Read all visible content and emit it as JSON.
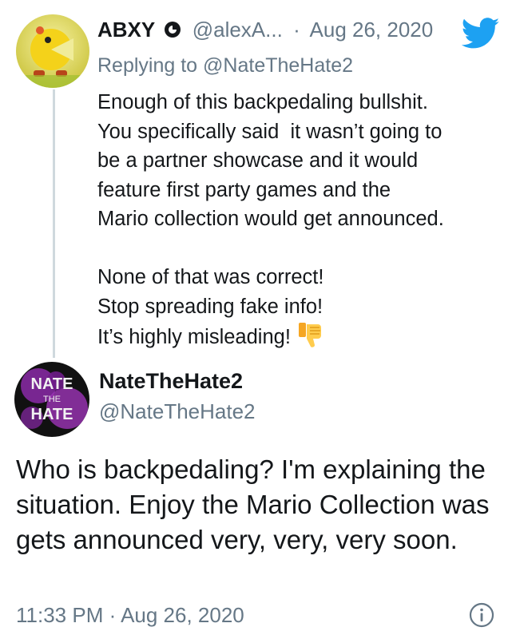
{
  "reply_tweet": {
    "display_name": "ABXY",
    "handle": "@alexA...",
    "separator": "·",
    "date": "Aug 26, 2020",
    "replying_prefix": "Replying to",
    "replying_to": "@NateTheHate2",
    "paragraph1": [
      "Enough of this backpedaling bullshit.",
      "You specifically said  it wasn’t going to",
      "be a partner showcase and it would",
      "feature first party games and the",
      "Mario collection would get announced."
    ],
    "paragraph2": [
      "None of that was correct!",
      "Stop spreading fake info!",
      "It’s highly misleading!"
    ],
    "emoji": "thumbs-down-icon"
  },
  "main_tweet": {
    "display_name": "NateTheHate2",
    "handle": "@NateTheHate2",
    "avatar_text": [
      "NATE",
      "THE",
      "HATE"
    ],
    "text": "Who is backpedaling? I'm explaining the situation. Enjoy the Mario Collection was gets announced very, very, very soon.",
    "time": "11:33 PM",
    "separator": "·",
    "date": "Aug 26, 2020"
  },
  "colors": {
    "text": "#14171a",
    "muted": "#657786",
    "twitter_blue": "#1da1f2",
    "thread_line": "#cfd9de"
  }
}
